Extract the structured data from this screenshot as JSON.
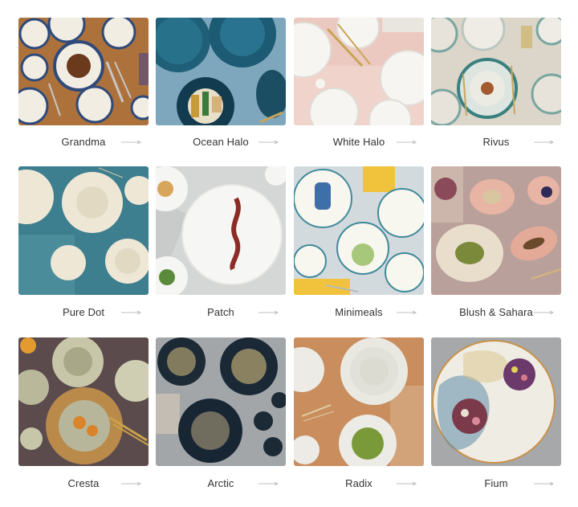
{
  "collections": [
    {
      "label": "Grandma",
      "bg": "#a86f3b"
    },
    {
      "label": "Ocean Halo",
      "bg": "#6f9cb4"
    },
    {
      "label": "White Halo",
      "bg": "#e9c4bc"
    },
    {
      "label": "Rivus",
      "bg": "#d8d4c8"
    },
    {
      "label": "Pure Dot",
      "bg": "#3f7f90"
    },
    {
      "label": "Patch",
      "bg": "#cfd0d0"
    },
    {
      "label": "Minimeals",
      "bg": "#cfd7dc"
    },
    {
      "label": "Blush & Sahara",
      "bg": "#b89a92"
    },
    {
      "label": "Cresta",
      "bg": "#5d4c4c"
    },
    {
      "label": "Arctic",
      "bg": "#9ea3a5"
    },
    {
      "label": "Radix",
      "bg": "#c98a5a"
    },
    {
      "label": "Fium",
      "bg": "#a8a9ab"
    }
  ]
}
